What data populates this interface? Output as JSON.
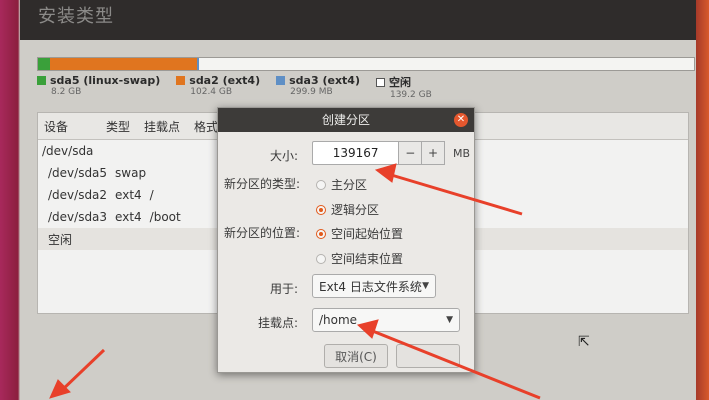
{
  "window_title": "安装类型",
  "partition_bar": {
    "segments": [
      {
        "fraction": 0.018,
        "color": "#3aa03a"
      },
      {
        "fraction": 0.225,
        "color": "#e0751f"
      },
      {
        "fraction": 0.002,
        "color": "#5f8fc5"
      },
      {
        "fraction": 0.755,
        "color": "#f4f4f2"
      }
    ]
  },
  "legend": [
    {
      "name": "sda5 (linux-swap)",
      "size": "8.2 GB",
      "color": "#3aa03a"
    },
    {
      "name": "sda2 (ext4)",
      "size": "102.4 GB",
      "color": "#e0751f"
    },
    {
      "name": "sda3 (ext4)",
      "size": "299.9 MB",
      "color": "#5f8fc5"
    },
    {
      "name": "空闲",
      "size": "139.2 GB",
      "color": "#ffffff"
    }
  ],
  "table": {
    "headers": [
      "设备",
      "类型",
      "挂载点",
      "格式化"
    ],
    "rows": [
      {
        "device": "/dev/sda",
        "type": "",
        "mount": ""
      },
      {
        "device": "/dev/sda5",
        "type": "swap",
        "mount": ""
      },
      {
        "device": "/dev/sda2",
        "type": "ext4",
        "mount": "/"
      },
      {
        "device": "/dev/sda3",
        "type": "ext4",
        "mount": "/boot"
      },
      {
        "device": "空闲",
        "type": "",
        "mount": ""
      }
    ]
  },
  "dialog": {
    "title": "创建分区",
    "size_label": "大小:",
    "size_value": "139167",
    "minus": "−",
    "plus": "+",
    "unit": "MB",
    "type_label": "新分区的类型:",
    "type_options": [
      "主分区",
      "逻辑分区"
    ],
    "type_selected": 1,
    "location_label": "新分区的位置:",
    "location_options": [
      "空间起始位置",
      "空间结束位置"
    ],
    "location_selected": 0,
    "use_label": "用于:",
    "use_value": "Ext4 日志文件系统",
    "mount_label": "挂载点:",
    "mount_value": "/home",
    "cancel_label": "取消(C)"
  },
  "colors": {
    "accent": "#e25a1c",
    "annotation_arrow": "#e8402a"
  }
}
